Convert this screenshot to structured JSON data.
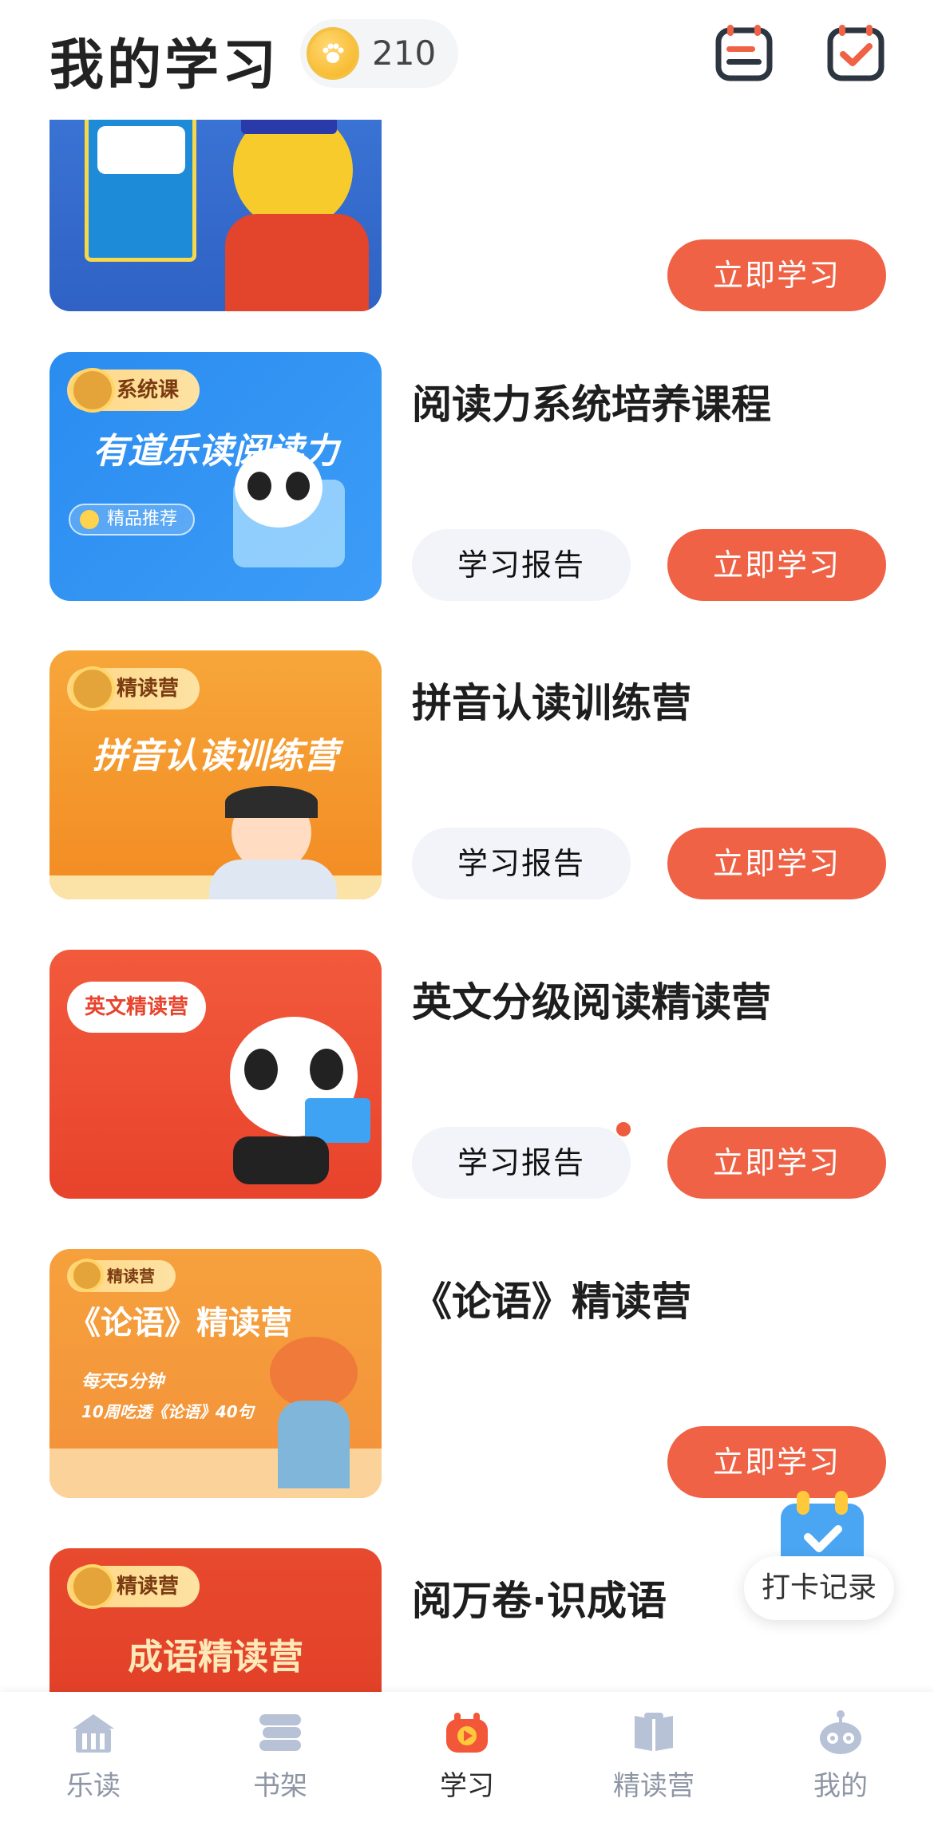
{
  "header": {
    "title": "我的学习",
    "coins": "210"
  },
  "courses": [
    {
      "title": "",
      "thumb_text": "",
      "study_label": "立即学习"
    },
    {
      "title": "阅读力系统培养课程",
      "tag": "系统课",
      "thumb_title": "有道乐读阅读力",
      "thumb_badge": "精品推荐",
      "report_label": "学习报告",
      "study_label": "立即学习"
    },
    {
      "title": "拼音认读训练营",
      "tag": "精读营",
      "thumb_title": "拼音认读训练营",
      "report_label": "学习报告",
      "study_label": "立即学习"
    },
    {
      "title": "英文分级阅读精读营",
      "tag": "英文精读营",
      "report_label": "学习报告",
      "study_label": "立即学习"
    },
    {
      "title": "《论语》精读营",
      "tag": "精读营",
      "thumb_title": "《论语》精读营",
      "thumb_line1": "每天5分钟",
      "thumb_line2": "10周吃透《论语》40句",
      "study_label": "立即学习"
    },
    {
      "title": "阅万卷·识成语",
      "tag": "精读营",
      "thumb_title": "成语精读营"
    }
  ],
  "checkin": {
    "label": "打卡记录"
  },
  "nav": {
    "items": [
      {
        "label": "乐读",
        "icon": "home-icon"
      },
      {
        "label": "书架",
        "icon": "bookshelf-icon"
      },
      {
        "label": "学习",
        "icon": "play-icon",
        "active": true
      },
      {
        "label": "精读营",
        "icon": "book-icon"
      },
      {
        "label": "我的",
        "icon": "robot-icon"
      }
    ]
  },
  "colors": {
    "accent": "#ef6245",
    "report_bg": "#f2f4f9",
    "nav_inactive": "#8e96a5"
  }
}
